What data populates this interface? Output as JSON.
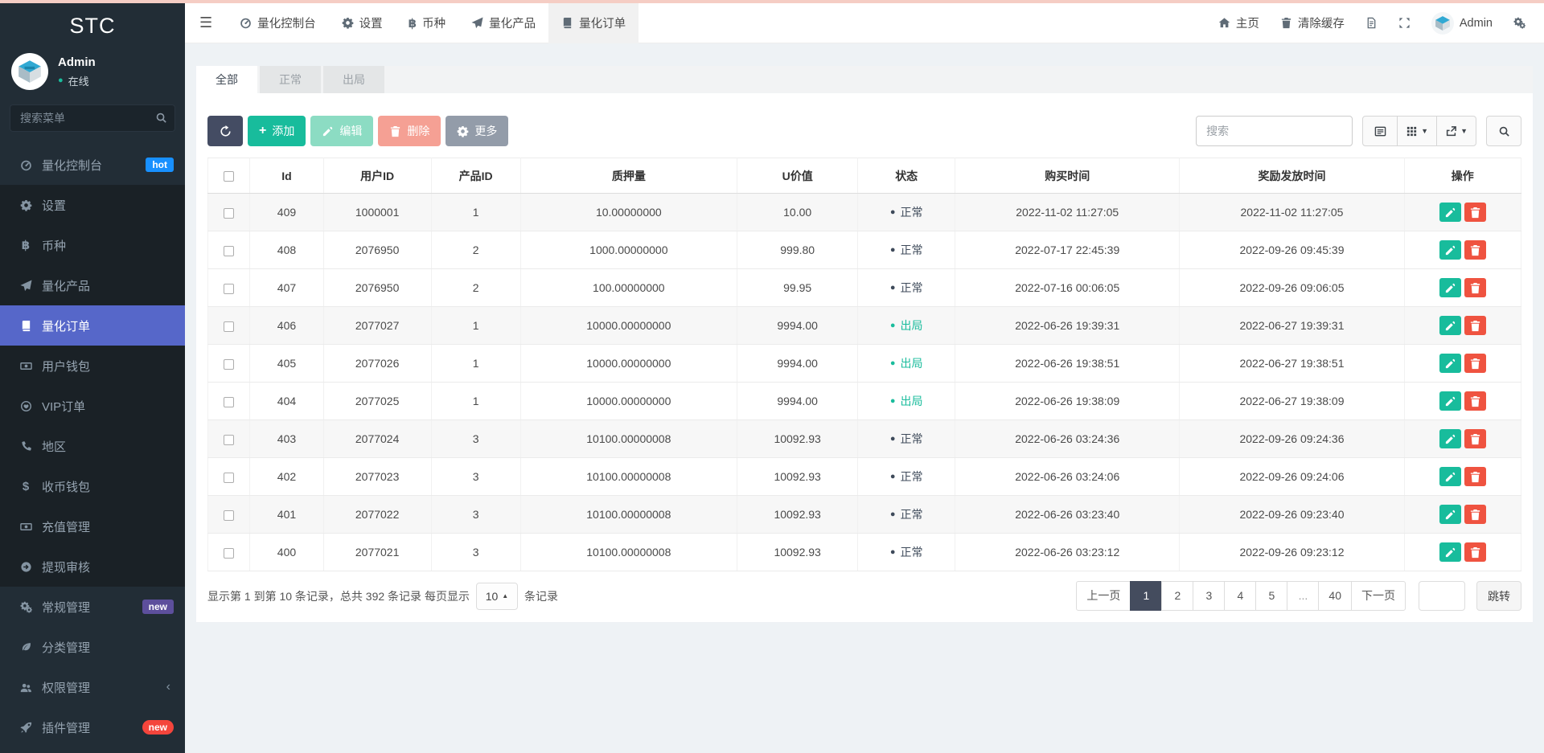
{
  "brand": "STC",
  "colors": {
    "accent_green": "#18bc9c",
    "accent_red": "#ef5340",
    "active_menu": "#5667c9",
    "dark_button": "#444c63",
    "badge_hot": "#1890ff",
    "badge_new_purple": "#5d4f9c",
    "badge_new_red": "#f4453c",
    "status_normal": "#3e4a5a",
    "status_out": "#1abc9c"
  },
  "sidebar": {
    "user": {
      "name": "Admin",
      "status": "在线"
    },
    "search_placeholder": "搜索菜单",
    "items": [
      {
        "label": "量化控制台",
        "icon": "dashboard",
        "badge": "hot",
        "badge_style": "blue",
        "group": "base"
      },
      {
        "label": "设置",
        "icon": "gear",
        "group": "dark"
      },
      {
        "label": "币种",
        "icon": "bitcoin",
        "group": "dark"
      },
      {
        "label": "量化产品",
        "icon": "plane",
        "group": "dark"
      },
      {
        "label": "量化订单",
        "icon": "book",
        "group": "dark",
        "active": true
      },
      {
        "label": "用户钱包",
        "icon": "money",
        "group": "dark"
      },
      {
        "label": "VIP订单",
        "icon": "heart-circle",
        "group": "dark"
      },
      {
        "label": "地区",
        "icon": "phone",
        "group": "dark"
      },
      {
        "label": "收币钱包",
        "icon": "dollar",
        "group": "dark"
      },
      {
        "label": "充值管理",
        "icon": "money",
        "group": "dark"
      },
      {
        "label": "提现审核",
        "icon": "arrow-circle",
        "group": "dark"
      },
      {
        "label": "常规管理",
        "icon": "cogs",
        "badge": "new",
        "badge_style": "purple",
        "group": "base"
      },
      {
        "label": "分类管理",
        "icon": "leaf",
        "group": "base"
      },
      {
        "label": "权限管理",
        "icon": "users",
        "chevron": "‹",
        "group": "base"
      },
      {
        "label": "插件管理",
        "icon": "rocket",
        "badge": "new",
        "badge_style": "red",
        "group": "base"
      }
    ]
  },
  "topbar": {
    "tabs": [
      {
        "label": "量化控制台",
        "icon": "dashboard"
      },
      {
        "label": "设置",
        "icon": "gear"
      },
      {
        "label": "币种",
        "icon": "bitcoin"
      },
      {
        "label": "量化产品",
        "icon": "plane"
      },
      {
        "label": "量化订单",
        "icon": "book",
        "active": true
      }
    ],
    "right": {
      "home": "主页",
      "clear_cache": "清除缓存",
      "user": "Admin"
    }
  },
  "page": {
    "tabs": [
      {
        "label": "全部",
        "active": true
      },
      {
        "label": "正常"
      },
      {
        "label": "出局"
      }
    ],
    "toolbar": {
      "add": "添加",
      "edit": "编辑",
      "del": "删除",
      "more": "更多"
    },
    "search_placeholder": "搜索",
    "table": {
      "columns": [
        "Id",
        "用户ID",
        "产品ID",
        "质押量",
        "U价值",
        "状态",
        "购买时间",
        "奖励发放时间",
        "操作"
      ],
      "rows": [
        {
          "id": "409",
          "user_id": "1000001",
          "product_id": "1",
          "pledge": "10.00000000",
          "u_value": "10.00",
          "status": "正常",
          "status_type": "normal",
          "buy_time": "2022-11-02 11:27:05",
          "reward_time": "2022-11-02 11:27:05"
        },
        {
          "id": "408",
          "user_id": "2076950",
          "product_id": "2",
          "pledge": "1000.00000000",
          "u_value": "999.80",
          "status": "正常",
          "status_type": "normal",
          "buy_time": "2022-07-17 22:45:39",
          "reward_time": "2022-09-26 09:45:39"
        },
        {
          "id": "407",
          "user_id": "2076950",
          "product_id": "2",
          "pledge": "100.00000000",
          "u_value": "99.95",
          "status": "正常",
          "status_type": "normal",
          "buy_time": "2022-07-16 00:06:05",
          "reward_time": "2022-09-26 09:06:05"
        },
        {
          "id": "406",
          "user_id": "2077027",
          "product_id": "1",
          "pledge": "10000.00000000",
          "u_value": "9994.00",
          "status": "出局",
          "status_type": "out",
          "buy_time": "2022-06-26 19:39:31",
          "reward_time": "2022-06-27 19:39:31"
        },
        {
          "id": "405",
          "user_id": "2077026",
          "product_id": "1",
          "pledge": "10000.00000000",
          "u_value": "9994.00",
          "status": "出局",
          "status_type": "out",
          "buy_time": "2022-06-26 19:38:51",
          "reward_time": "2022-06-27 19:38:51"
        },
        {
          "id": "404",
          "user_id": "2077025",
          "product_id": "1",
          "pledge": "10000.00000000",
          "u_value": "9994.00",
          "status": "出局",
          "status_type": "out",
          "buy_time": "2022-06-26 19:38:09",
          "reward_time": "2022-06-27 19:38:09"
        },
        {
          "id": "403",
          "user_id": "2077024",
          "product_id": "3",
          "pledge": "10100.00000008",
          "u_value": "10092.93",
          "status": "正常",
          "status_type": "normal",
          "buy_time": "2022-06-26 03:24:36",
          "reward_time": "2022-09-26 09:24:36"
        },
        {
          "id": "402",
          "user_id": "2077023",
          "product_id": "3",
          "pledge": "10100.00000008",
          "u_value": "10092.93",
          "status": "正常",
          "status_type": "normal",
          "buy_time": "2022-06-26 03:24:06",
          "reward_time": "2022-09-26 09:24:06"
        },
        {
          "id": "401",
          "user_id": "2077022",
          "product_id": "3",
          "pledge": "10100.00000008",
          "u_value": "10092.93",
          "status": "正常",
          "status_type": "normal",
          "buy_time": "2022-06-26 03:23:40",
          "reward_time": "2022-09-26 09:23:40"
        },
        {
          "id": "400",
          "user_id": "2077021",
          "product_id": "3",
          "pledge": "10100.00000008",
          "u_value": "10092.93",
          "status": "正常",
          "status_type": "normal",
          "buy_time": "2022-06-26 03:23:12",
          "reward_time": "2022-09-26 09:23:12"
        }
      ]
    },
    "footer": {
      "info_prefix": "显示第 1 到第 10 条记录，总共 392 条记录 每页显示",
      "page_size": "10",
      "info_suffix": "条记录",
      "pages": [
        "上一页",
        "1",
        "2",
        "3",
        "4",
        "5",
        "...",
        "40",
        "下一页"
      ],
      "active_page": "1",
      "jump_label": "跳转"
    }
  }
}
